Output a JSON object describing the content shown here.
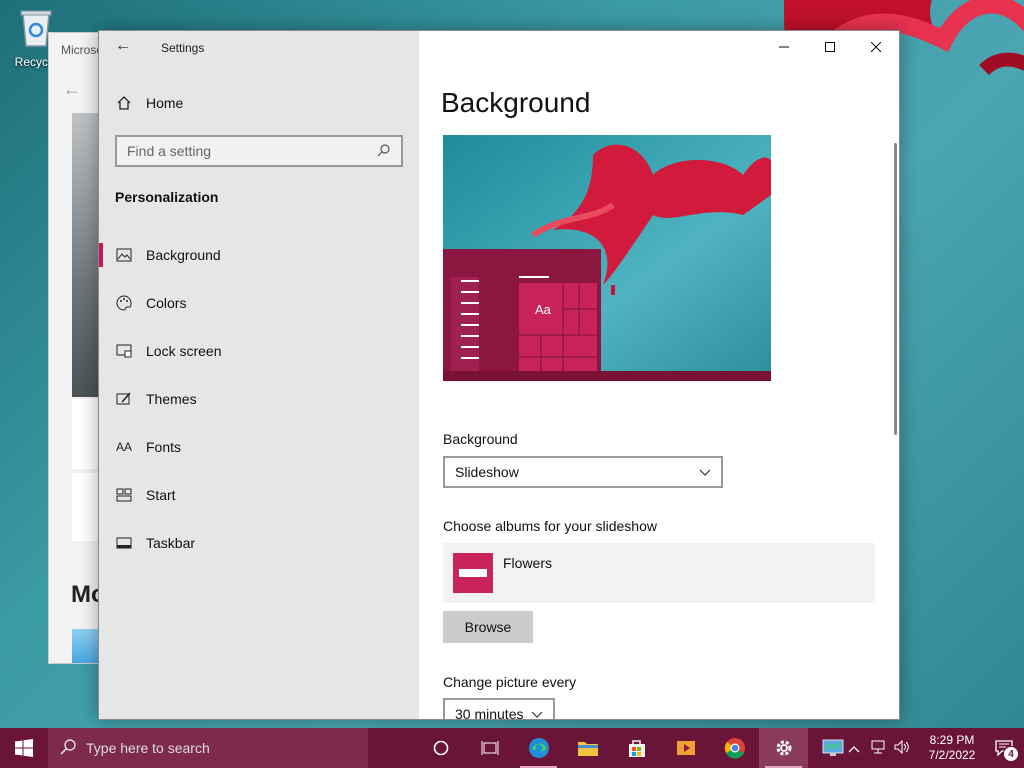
{
  "desktop": {
    "recycle_label": "Recycle",
    "bg_window_title": "Microso",
    "bg_window_heading": "Mo"
  },
  "settings": {
    "app_title": "Settings",
    "home_label": "Home",
    "search_placeholder": "Find a setting",
    "section_heading": "Personalization",
    "nav": [
      {
        "label": "Background",
        "icon": "picture-icon",
        "active": true
      },
      {
        "label": "Colors",
        "icon": "palette-icon",
        "active": false
      },
      {
        "label": "Lock screen",
        "icon": "lock-screen-icon",
        "active": false
      },
      {
        "label": "Themes",
        "icon": "themes-icon",
        "active": false
      },
      {
        "label": "Fonts",
        "icon": "fonts-icon",
        "active": false
      },
      {
        "label": "Start",
        "icon": "start-icon",
        "active": false
      },
      {
        "label": "Taskbar",
        "icon": "taskbar-icon",
        "active": false
      }
    ],
    "page_title": "Background",
    "preview_sample_text": "Aa",
    "background_label": "Background",
    "background_value": "Slideshow",
    "albums_label": "Choose albums for your slideshow",
    "album_name": "Flowers",
    "browse_label": "Browse",
    "change_label": "Change picture every",
    "change_value": "30 minutes"
  },
  "taskbar": {
    "search_placeholder": "Type here to search",
    "time": "8:29 PM",
    "date": "7/2/2022",
    "notification_count": "4",
    "accent_color": "#6a1437"
  }
}
